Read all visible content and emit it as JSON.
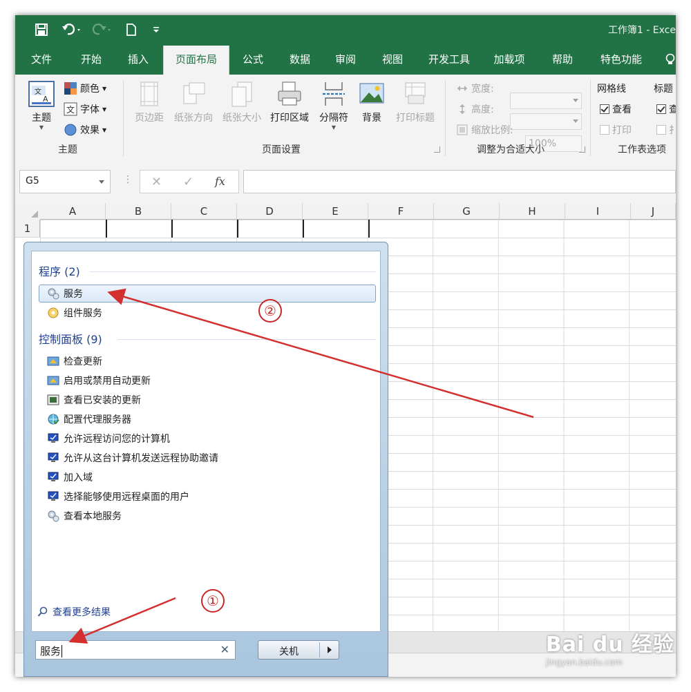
{
  "titlebar": {
    "title": "工作簿1  -  Exce",
    "bg_color": "#217346"
  },
  "tabs": [
    "文件",
    "开始",
    "插入",
    "页面布局",
    "公式",
    "数据",
    "审阅",
    "视图",
    "开发工具",
    "加载项",
    "帮助",
    "特色功能"
  ],
  "ribbon": {
    "theme_group": {
      "label": "主题",
      "theme_btn": "主题",
      "colors": "颜色",
      "fonts": "字体",
      "effects": "效果"
    },
    "page_setup": {
      "label": "页面设置",
      "margins": "页边距",
      "orientation": "纸张方向",
      "size": "纸张大小",
      "print_area": "打印区域",
      "breaks": "分隔符",
      "background": "背景",
      "print_titles": "打印标题"
    },
    "scale": {
      "label": "调整为合适大小",
      "width": "宽度:",
      "height": "高度:",
      "scale": "缩放比例:",
      "scale_value": "100%"
    },
    "sheet_options": {
      "label": "工作表选项",
      "gridlines": "网格线",
      "headings": "标题",
      "view": "查看",
      "print": "打印",
      "view_cut": "查",
      "print_cut": "扌"
    }
  },
  "formula_bar": {
    "namebox": "G5",
    "fx": "fx",
    "cancel": "✕",
    "enter": "✓"
  },
  "grid": {
    "columns": [
      "A",
      "B",
      "C",
      "D",
      "E",
      "F",
      "G",
      "H",
      "I",
      "J"
    ],
    "rows": [
      "1"
    ]
  },
  "start_menu": {
    "programs_header": "程序 (2)",
    "programs": [
      {
        "label": "服务",
        "icon": "gear-services-icon"
      },
      {
        "label": "组件服务",
        "icon": "component-services-icon"
      }
    ],
    "control_panel_header": "控制面板 (9)",
    "control_panel": [
      {
        "label": "检查更新",
        "icon": "windows-update-icon"
      },
      {
        "label": "启用或禁用自动更新",
        "icon": "windows-update-icon"
      },
      {
        "label": "查看已安装的更新",
        "icon": "installed-updates-icon"
      },
      {
        "label": "配置代理服务器",
        "icon": "proxy-globe-icon"
      },
      {
        "label": "允许远程访问您的计算机",
        "icon": "monitor-icon"
      },
      {
        "label": "允许从这台计算机发送远程协助邀请",
        "icon": "monitor-icon"
      },
      {
        "label": "加入域",
        "icon": "monitor-icon"
      },
      {
        "label": "选择能够使用远程桌面的用户",
        "icon": "monitor-icon"
      },
      {
        "label": "查看本地服务",
        "icon": "gear-services-icon"
      }
    ],
    "see_more": "查看更多结果",
    "search_value": "服务",
    "shutdown": "关机"
  },
  "annotations": {
    "step1": "①",
    "step2": "②",
    "arrow_color": "#d32f2f"
  },
  "watermark": {
    "brand": "Bai du 经验",
    "url": "jingyan.baidu.com"
  }
}
